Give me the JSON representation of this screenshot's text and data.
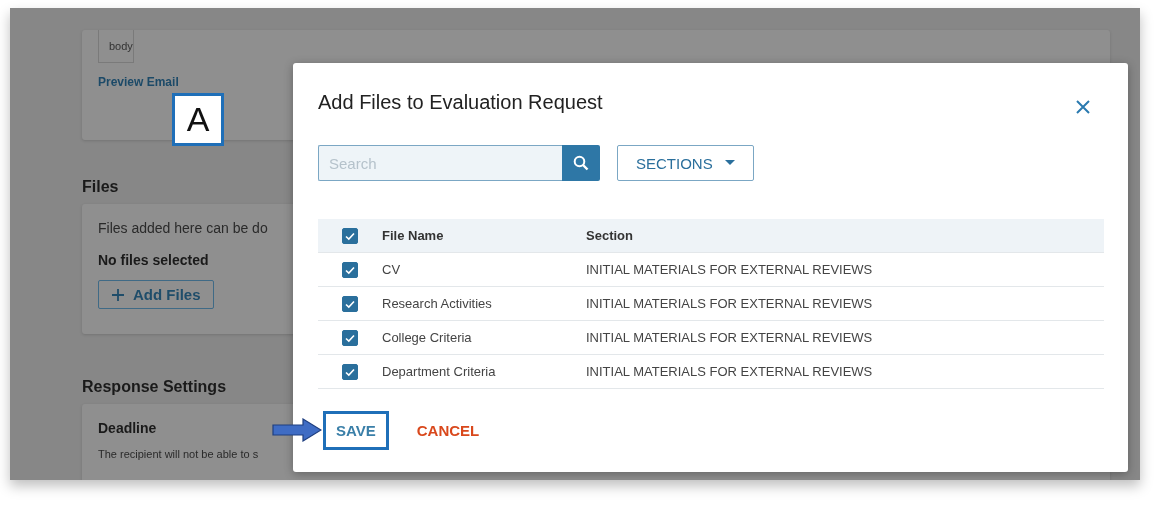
{
  "background_page": {
    "email_card": {
      "body_label": "body",
      "link": "Preview Email"
    },
    "files": {
      "heading": "Files",
      "description": "Files added here can be do",
      "status": "No files selected",
      "add_button": "Add Files"
    },
    "response_settings": {
      "heading": "Response Settings",
      "deadline_title": "Deadline",
      "deadline_text": "The recipient will not be able to s"
    }
  },
  "callout": {
    "label": "A"
  },
  "dialog": {
    "title": "Add Files to Evaluation Request",
    "search": {
      "placeholder": "Search"
    },
    "sections_button": "SECTIONS",
    "table": {
      "all_checked": true,
      "columns": [
        "File Name",
        "Section"
      ],
      "rows": [
        {
          "file_name": "CV",
          "section": "INITIAL MATERIALS FOR EXTERNAL REVIEWS",
          "checked": true
        },
        {
          "file_name": "Research Activities",
          "section": "INITIAL MATERIALS FOR EXTERNAL REVIEWS",
          "checked": true
        },
        {
          "file_name": "College Criteria",
          "section": "INITIAL MATERIALS FOR EXTERNAL REVIEWS",
          "checked": true
        },
        {
          "file_name": "Department Criteria",
          "section": "INITIAL MATERIALS FOR EXTERNAL REVIEWS",
          "checked": true
        }
      ]
    },
    "buttons": {
      "save": "SAVE",
      "cancel": "CANCEL"
    }
  }
}
